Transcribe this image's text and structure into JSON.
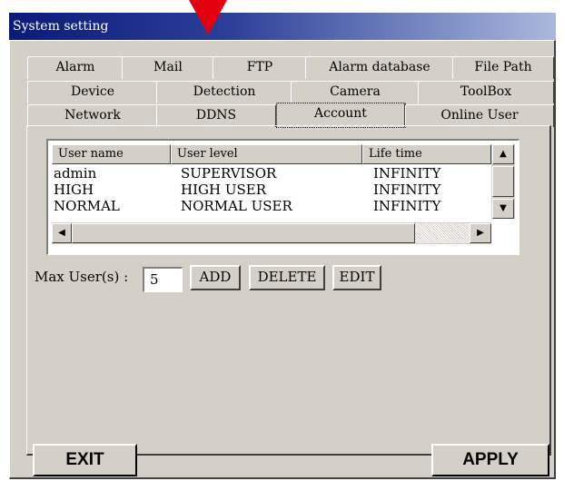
{
  "window": {
    "title": "System setting"
  },
  "tabs_row1": [
    "Alarm",
    "Mail",
    "FTP",
    "Alarm database",
    "File Path"
  ],
  "tabs_row2": [
    "Device",
    "Detection",
    "Camera",
    "ToolBox"
  ],
  "tabs_row3": [
    "Network",
    "DDNS",
    "Account",
    "Online User"
  ],
  "active_tab": "Account",
  "table": {
    "columns": [
      "User name",
      "User level",
      "Life time"
    ],
    "rows": [
      [
        "admin",
        "SUPERVISOR",
        "INFINITY"
      ],
      [
        "HIGH",
        "HIGH USER",
        "INFINITY"
      ],
      [
        "NORMAL",
        "NORMAL USER",
        "INFINITY"
      ]
    ]
  },
  "max_users": {
    "label": "Max User(s) :",
    "value": "5"
  },
  "buttons": {
    "add": "ADD",
    "delete": "DELETE",
    "edit": "EDIT",
    "exit": "EXIT",
    "apply": "APPLY"
  },
  "colors": {
    "pointer_arrow": "#e3000f",
    "titlebar_start": "#0a1a78",
    "titlebar_end": "#a9b9dd",
    "dialog_bg": "#d4d0c8"
  },
  "icons": [
    "arrow-pointer-icon",
    "scroll-up-arrow-icon",
    "scroll-down-arrow-icon",
    "scroll-left-arrow-icon",
    "scroll-right-arrow-icon"
  ]
}
